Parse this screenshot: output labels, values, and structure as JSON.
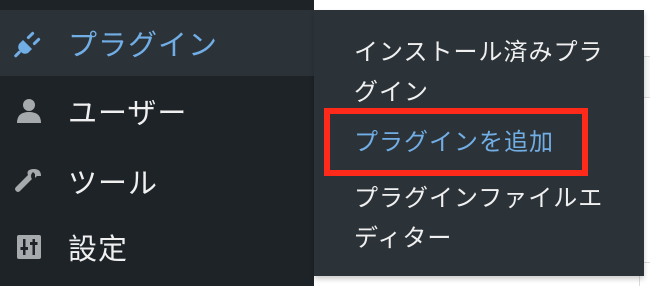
{
  "sidebar": {
    "items": [
      {
        "label": "プラグイン",
        "icon": "plugin-icon",
        "current": true
      },
      {
        "label": "ユーザー",
        "icon": "user-icon",
        "current": false
      },
      {
        "label": "ツール",
        "icon": "wrench-icon",
        "current": false
      },
      {
        "label": "設定",
        "icon": "settings-sliders-icon",
        "current": false
      }
    ]
  },
  "flyout": {
    "items": [
      {
        "label_line1": "インストール済みプラ",
        "label_line2": "グイン"
      },
      {
        "label_line1": "プラグインを追加",
        "label_line2": ""
      },
      {
        "label_line1": "プラグインファイルエ",
        "label_line2": "ディター"
      }
    ]
  },
  "colors": {
    "sidebar_bg": "#1d2327",
    "submenu_bg": "#2c3338",
    "accent": "#72aee6",
    "text": "#f0f0f1",
    "highlight": "#ff2a1a"
  }
}
